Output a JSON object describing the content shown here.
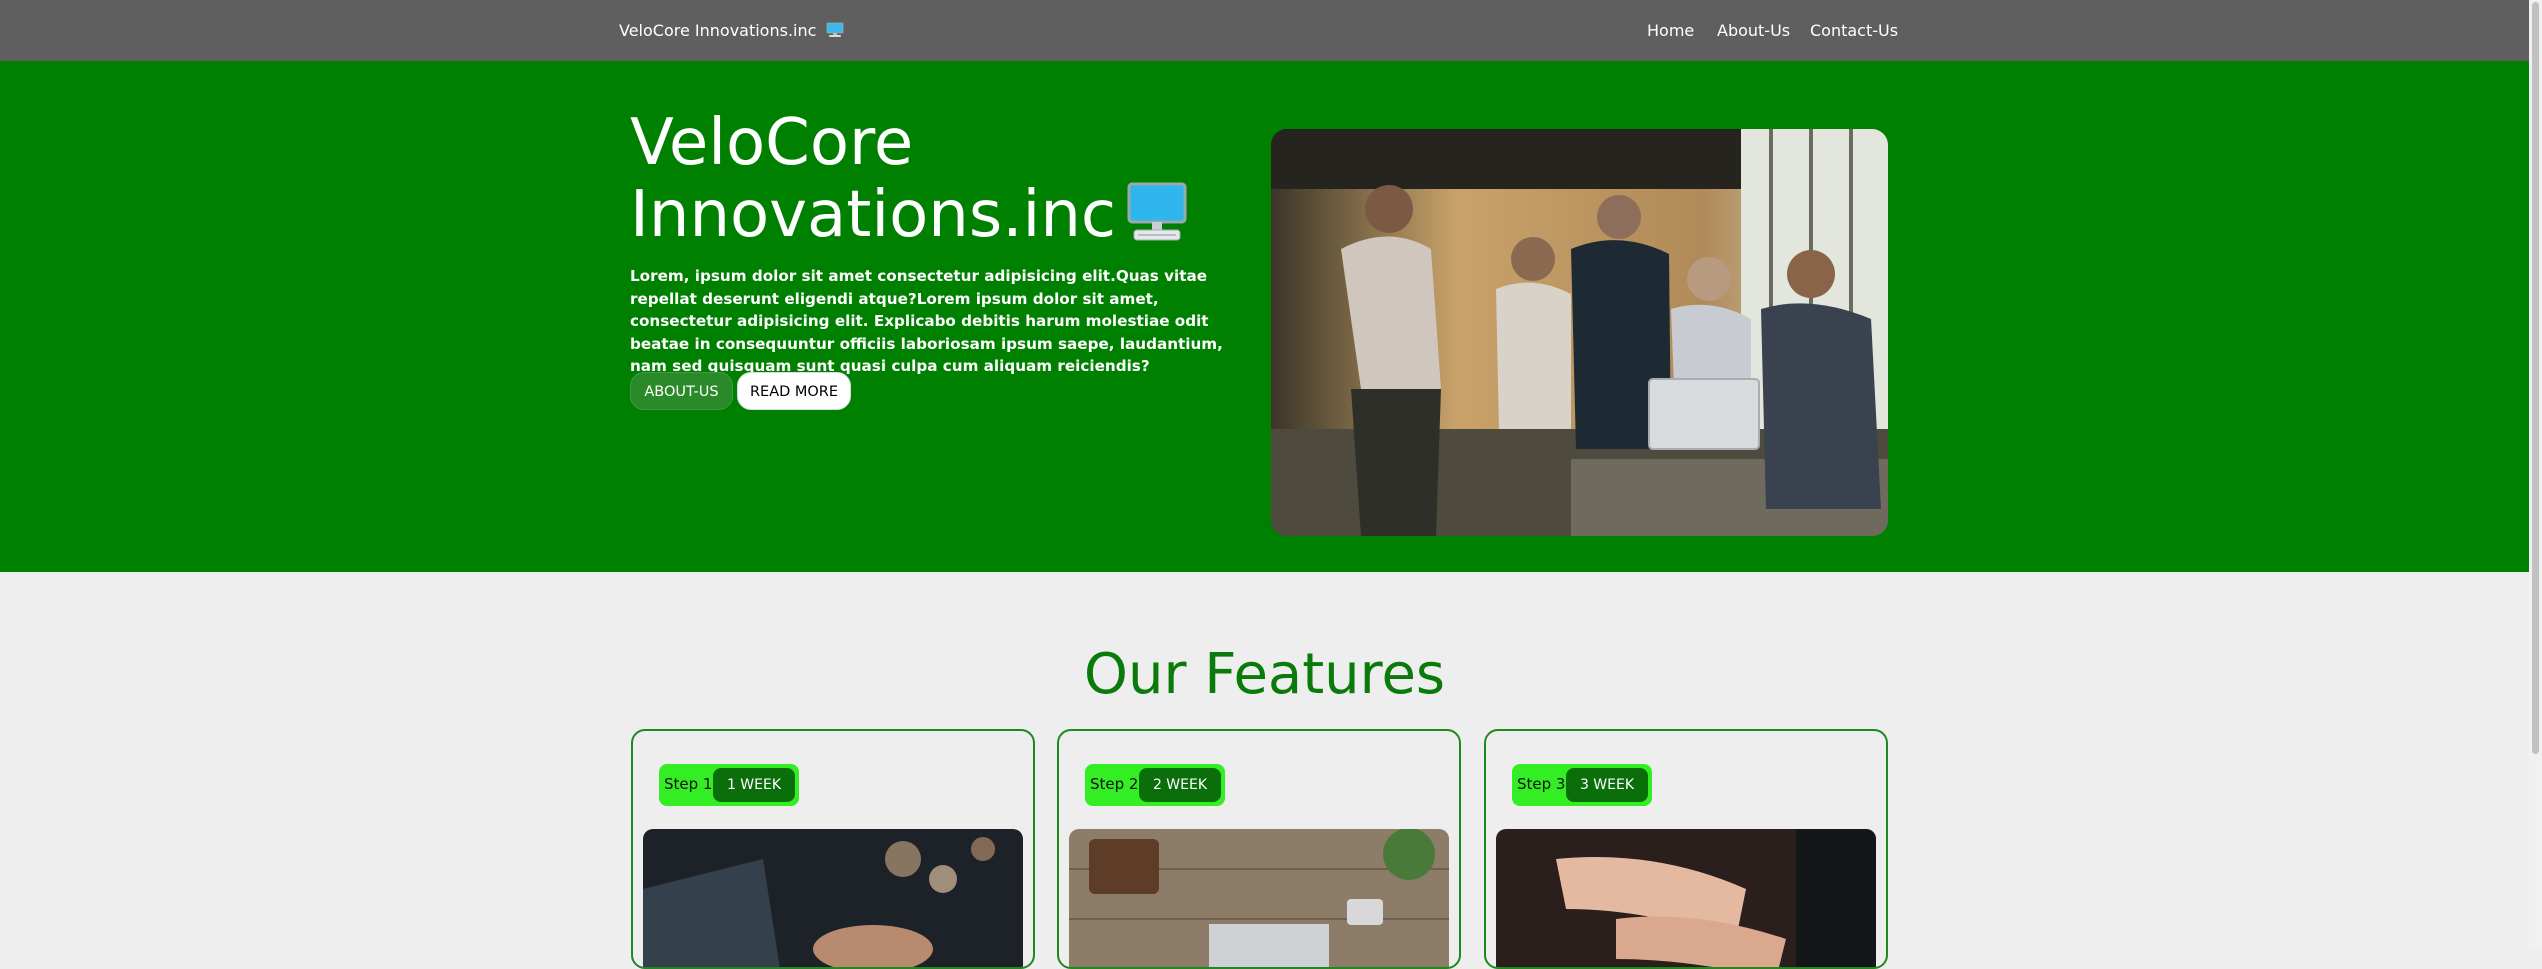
{
  "nav": {
    "brand": "VeloCore Innovations.inc",
    "links": [
      "Home",
      "About-Us",
      "Contact-Us"
    ]
  },
  "hero": {
    "title": "VeloCore Innovations.inc",
    "paragraph": "Lorem, ipsum dolor sit amet consectetur adipisicing elit.Quas vitae repellat deserunt eligendi atque?Lorem ipsum dolor sit amet, consectetur adipisicing elit. Explicabo debitis harum molestiae odit beatae in consequuntur officiis laboriosam ipsum saepe, laudantium, nam sed quisquam sunt quasi culpa cum aliquam reiciendis?",
    "buttons": {
      "about": "ABOUT-US",
      "read_more": "READ MORE"
    },
    "photo_icon": "team-photo"
  },
  "features": {
    "title": "Our Features",
    "cards": [
      {
        "step": "Step 1",
        "duration": "1 WEEK",
        "photo_icon": "laptop-typing-photo"
      },
      {
        "step": "Step 2",
        "duration": "2 WEEK",
        "photo_icon": "desk-flatlay-photo"
      },
      {
        "step": "Step 3",
        "duration": "3 WEEK",
        "photo_icon": "hands-keyboard-photo"
      }
    ]
  },
  "colors": {
    "navbar": "#5f5f5f",
    "hero_bg": "#008000",
    "page_bg": "#eeeeee",
    "features_title": "#0a7a0a",
    "step_pill": "#33ee22",
    "week_badge": "#0a6e0a"
  }
}
